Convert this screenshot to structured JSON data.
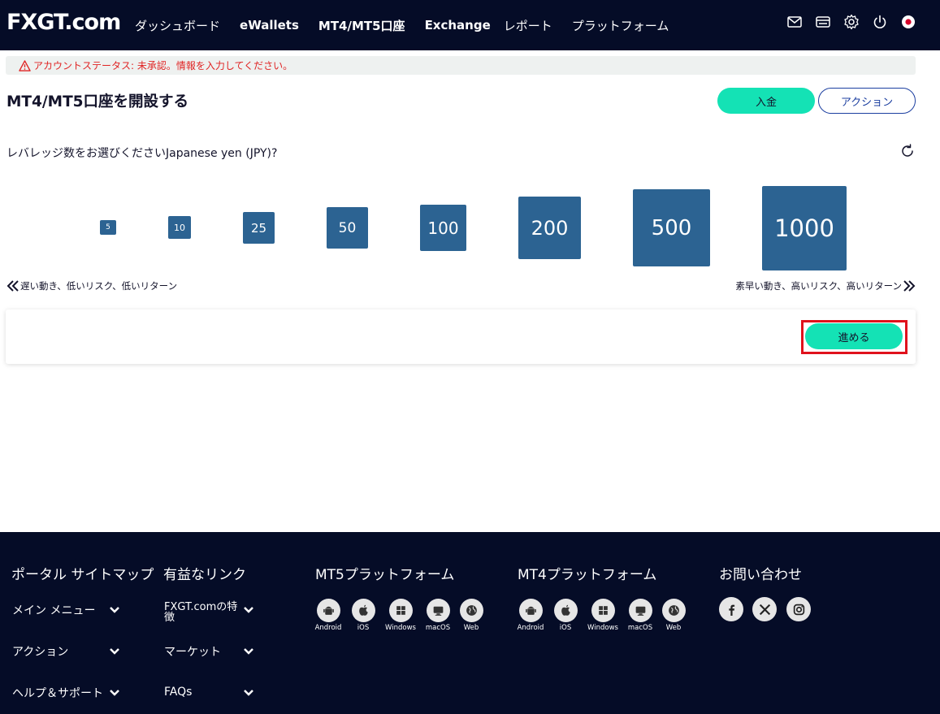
{
  "brand": {
    "logo_text": "FXGT.com",
    "accent": "#14e2b5",
    "navy": "#050c27",
    "lever_blue": "#2c6392"
  },
  "header": {
    "nav": [
      {
        "label": "ダッシュボード",
        "bold": false
      },
      {
        "label": "eWallets",
        "bold": true
      },
      {
        "label": "MT4/MT5口座",
        "bold": true
      },
      {
        "label": "Exchange",
        "bold": true
      },
      {
        "label": "レポート",
        "bold": false
      },
      {
        "label": "プラットフォーム",
        "bold": false
      }
    ],
    "icons": [
      "mail-icon",
      "wallet-icon",
      "gear-icon",
      "power-icon",
      "flag-japan-icon"
    ]
  },
  "alert": {
    "text": "アカウントステータス: 未承認。情報を入力してください。",
    "icon": "warning-icon"
  },
  "page": {
    "title": "MT4/MT5口座を開設する",
    "deposit_label": "入金",
    "action_label": "アクション",
    "question": "レバレッジ数をお選びくださいJapanese yen (JPY)?",
    "leverage_options": [
      "5",
      "10",
      "25",
      "50",
      "100",
      "200",
      "500",
      "1000"
    ],
    "risk_low": "遅い動き、低いリスク、低いリターン",
    "risk_high": "素早い動き、高いリスク、高いリターン",
    "next_label": "進める"
  },
  "footer": {
    "col1": {
      "title": "ポータル サイトマップ",
      "items": [
        "メイン メニュー",
        "アクション",
        "ヘルプ＆サポート"
      ]
    },
    "col2": {
      "title": "有益なリンク",
      "items": [
        "FXGT.comの特徴",
        "マーケット",
        "FAQs"
      ]
    },
    "mt5": {
      "title": "MT5プラットフォーム",
      "platforms": [
        "Android",
        "iOS",
        "Windows",
        "macOS",
        "Web"
      ]
    },
    "mt4": {
      "title": "MT4プラットフォーム",
      "platforms": [
        "Android",
        "iOS",
        "Windows",
        "macOS",
        "Web"
      ]
    },
    "contact": {
      "title": "お問い合わせ",
      "socials": [
        "facebook-icon",
        "x-icon",
        "instagram-icon"
      ]
    }
  }
}
